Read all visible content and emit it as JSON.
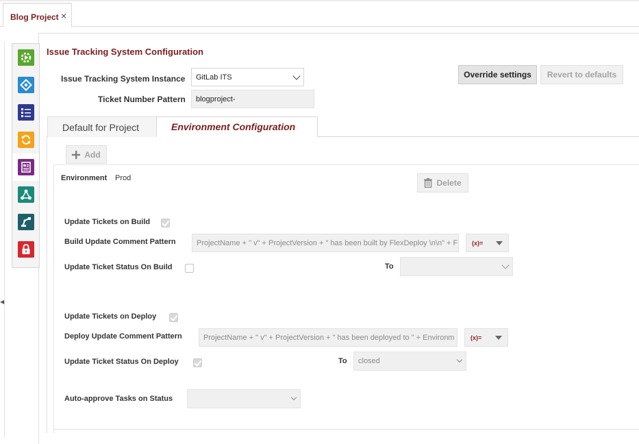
{
  "doc_tab": {
    "title": "Blog Project",
    "close_glyph": "×"
  },
  "icon_toolbar": [
    {
      "icon": "gear-play-icon",
      "color": "#5aa72d"
    },
    {
      "icon": "workflow-diamond-icon",
      "color": "#2a8bd0"
    },
    {
      "icon": "checklist-icon",
      "color": "#2f3a8f"
    },
    {
      "icon": "sync-icon",
      "color": "#f3a31b"
    },
    {
      "icon": "report-icon",
      "color": "#7b2a83"
    },
    {
      "icon": "network-icon",
      "color": "#1b8a7a"
    },
    {
      "icon": "robot-arm-icon",
      "color": "#1f5f6b"
    },
    {
      "icon": "lock-icon",
      "color": "#d8262c"
    }
  ],
  "section_title": "Issue Tracking System Configuration",
  "its_instance": {
    "label": "Issue Tracking System Instance",
    "value": "GitLab ITS"
  },
  "ticket_pattern": {
    "label": "Ticket Number Pattern",
    "value": "blogproject-"
  },
  "buttons": {
    "override": "Override settings",
    "revert": "Revert to defaults",
    "add": "Add",
    "delete": "Delete"
  },
  "tabs": {
    "default": "Default for Project",
    "env": "Environment Configuration"
  },
  "environment": {
    "label": "Environment",
    "value": "Prod"
  },
  "build": {
    "update_tickets_label": "Update Tickets on Build",
    "update_tickets_checked": true,
    "comment_label": "Build Update Comment Pattern",
    "comment_value": "ProjectName + \" v\" + ProjectVersion + \" has been built by FlexDeploy \\n\\n\" + F",
    "var_button": "(x)=",
    "status_label": "Update Ticket Status On Build",
    "status_checked": false,
    "to_label": "To",
    "to_value": ""
  },
  "deploy": {
    "update_tickets_label": "Update Tickets on Deploy",
    "update_tickets_checked": true,
    "comment_label": "Deploy Update Comment Pattern",
    "comment_value": "ProjectName + \" v\" + ProjectVersion + \" has been deployed to \" + Environm",
    "var_button": "(x)=",
    "status_label": "Update Ticket Status On Deploy",
    "status_checked": true,
    "to_label": "To",
    "to_value": "closed"
  },
  "auto_approve": {
    "label": "Auto-approve Tasks on Status",
    "value": ""
  }
}
